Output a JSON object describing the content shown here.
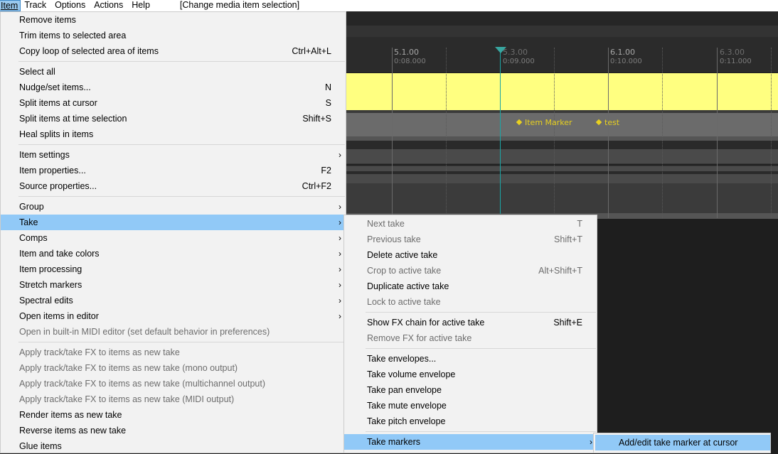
{
  "menubar": {
    "items": [
      {
        "label": "Item",
        "active": true
      },
      {
        "label": "Track"
      },
      {
        "label": "Options"
      },
      {
        "label": "Actions"
      },
      {
        "label": "Help"
      }
    ],
    "status": "[Change media item selection]"
  },
  "arrange": {
    "ruler": [
      {
        "bar": "5.1.00",
        "time": "0:08.000"
      },
      {
        "bar": "5.3.00",
        "time": "0:09.000"
      },
      {
        "bar": "6.1.00",
        "time": "0:10.000"
      },
      {
        "bar": "6.3.00",
        "time": "0:11.000"
      }
    ],
    "take_markers": [
      "Item Marker",
      "test"
    ],
    "colors": {
      "item": "#ffff80",
      "cursor": "#1aa6a6",
      "marker": "#e8d020"
    }
  },
  "item_menu": {
    "groups": [
      [
        {
          "label": "Remove items"
        },
        {
          "label": "Trim items to selected area"
        },
        {
          "label": "Copy loop of selected area of items",
          "shortcut": "Ctrl+Alt+L"
        }
      ],
      [
        {
          "label": "Select all"
        },
        {
          "label": "Nudge/set items...",
          "shortcut": "N"
        },
        {
          "label": "Split items at cursor",
          "shortcut": "S"
        },
        {
          "label": "Split items at time selection",
          "shortcut": "Shift+S"
        },
        {
          "label": "Heal splits in items"
        }
      ],
      [
        {
          "label": "Item settings",
          "submenu": true
        },
        {
          "label": "Item properties...",
          "shortcut": "F2"
        },
        {
          "label": "Source properties...",
          "shortcut": "Ctrl+F2"
        }
      ],
      [
        {
          "label": "Group",
          "submenu": true
        },
        {
          "label": "Take",
          "submenu": true,
          "highlighted": true
        },
        {
          "label": "Comps",
          "submenu": true
        },
        {
          "label": "Item and take colors",
          "submenu": true
        },
        {
          "label": "Item processing",
          "submenu": true
        },
        {
          "label": "Stretch markers",
          "submenu": true
        },
        {
          "label": "Spectral edits",
          "submenu": true
        },
        {
          "label": "Open items in editor",
          "submenu": true
        },
        {
          "label": "Open in built-in MIDI editor (set default behavior in preferences)",
          "disabled": true
        }
      ],
      [
        {
          "label": "Apply track/take FX to items as new take",
          "disabled": true
        },
        {
          "label": "Apply track/take FX to items as new take (mono output)",
          "disabled": true
        },
        {
          "label": "Apply track/take FX to items as new take (multichannel output)",
          "disabled": true
        },
        {
          "label": "Apply track/take FX to items as new take (MIDI output)",
          "disabled": true
        },
        {
          "label": "Render items as new take"
        },
        {
          "label": "Reverse items as new take"
        },
        {
          "label": "Glue items"
        }
      ]
    ]
  },
  "take_menu": {
    "groups": [
      [
        {
          "label": "Next take",
          "shortcut": "T",
          "disabled": true
        },
        {
          "label": "Previous take",
          "shortcut": "Shift+T",
          "disabled": true
        },
        {
          "label": "Delete active take"
        },
        {
          "label": "Crop to active take",
          "shortcut": "Alt+Shift+T",
          "disabled": true
        },
        {
          "label": "Duplicate active take"
        },
        {
          "label": "Lock to active take",
          "disabled": true
        }
      ],
      [
        {
          "label": "Show FX chain for active take",
          "shortcut": "Shift+E"
        },
        {
          "label": "Remove FX for active take",
          "disabled": true
        }
      ],
      [
        {
          "label": "Take envelopes..."
        },
        {
          "label": "Take volume envelope"
        },
        {
          "label": "Take pan envelope"
        },
        {
          "label": "Take mute envelope"
        },
        {
          "label": "Take pitch envelope"
        }
      ],
      [
        {
          "label": "Take markers",
          "submenu": true,
          "highlighted": true
        }
      ]
    ]
  },
  "take_markers_menu": {
    "items": [
      {
        "label": "Add/edit take marker at cursor",
        "highlighted": true
      }
    ]
  }
}
